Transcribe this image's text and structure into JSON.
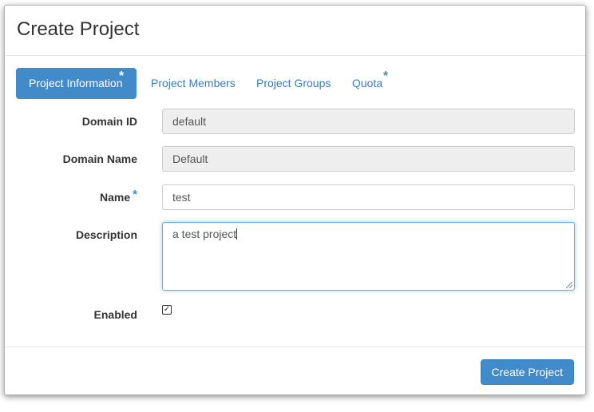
{
  "modal": {
    "title": "Create Project"
  },
  "tabs": [
    {
      "label": "Project Information",
      "required": "*"
    },
    {
      "label": "Project Members"
    },
    {
      "label": "Project Groups"
    },
    {
      "label": "Quota",
      "required": "*"
    }
  ],
  "form": {
    "domain_id": {
      "label": "Domain ID",
      "value": "default"
    },
    "domain_name": {
      "label": "Domain Name",
      "value": "Default"
    },
    "name": {
      "label": "Name",
      "required": "*",
      "value": "test"
    },
    "description": {
      "label": "Description",
      "value": "a test project"
    },
    "enabled": {
      "label": "Enabled",
      "checked": true,
      "check_glyph": "✓"
    }
  },
  "footer": {
    "submit_label": "Create Project"
  },
  "colors": {
    "primary": "#428bca",
    "link": "#3a7bbf",
    "disabled_bg": "#eeeeee"
  }
}
